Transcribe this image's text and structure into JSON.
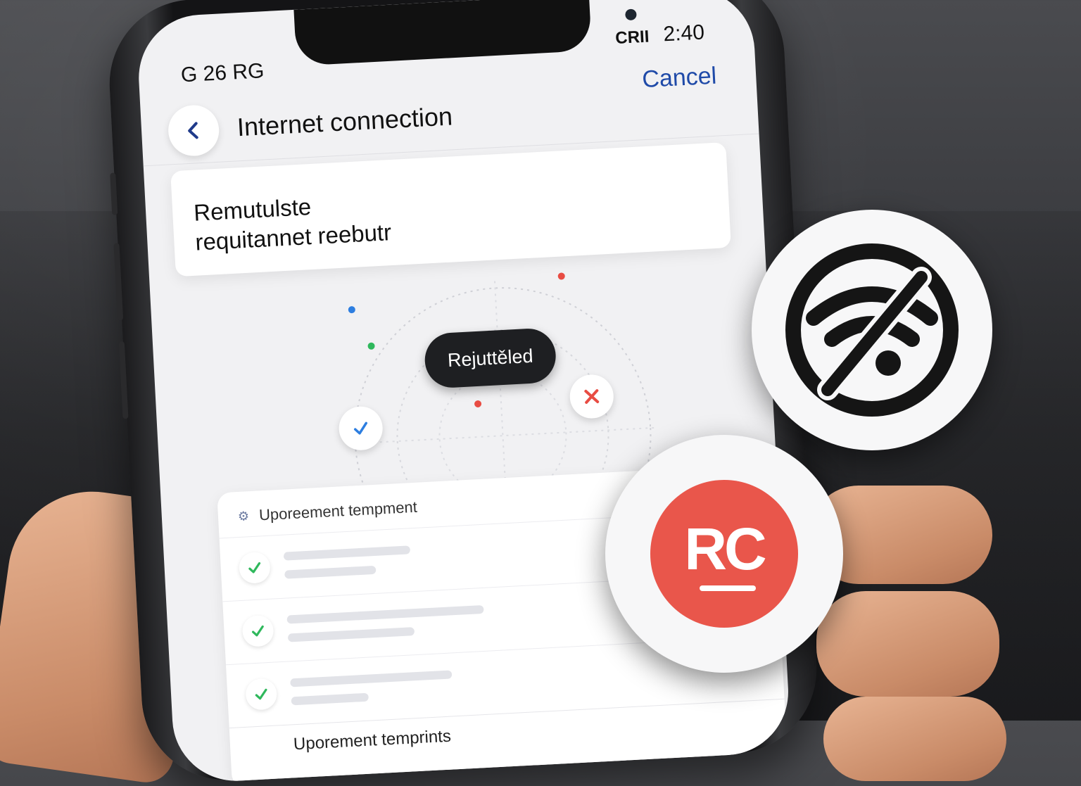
{
  "status_bar": {
    "left": "G 26 RG",
    "carrier": "CRII",
    "time": "2:40"
  },
  "nav": {
    "title": "Internet connection",
    "cancel_label": "Cancel",
    "back_icon": "chevron-left-icon"
  },
  "card": {
    "line1": "Remutulste",
    "line2": "requitannet reebutr"
  },
  "radar": {
    "status_label": "Rejuttěled",
    "success_icon": "check-icon",
    "fail_icon": "x-icon"
  },
  "list": {
    "header": "Uporeement tempment",
    "footer": "Uporement temprints",
    "rows": [
      {
        "status": "check"
      },
      {
        "status": "check"
      },
      {
        "status": "check"
      }
    ]
  },
  "badges": {
    "wifi_off_icon": "wifi-off-icon",
    "rc_logo": "RC"
  },
  "colors": {
    "accent": "#1f4aa8",
    "success": "#2fb85c",
    "error": "#e84c43",
    "brand_rc": "#e9564b",
    "pill": "#1e1f22"
  }
}
